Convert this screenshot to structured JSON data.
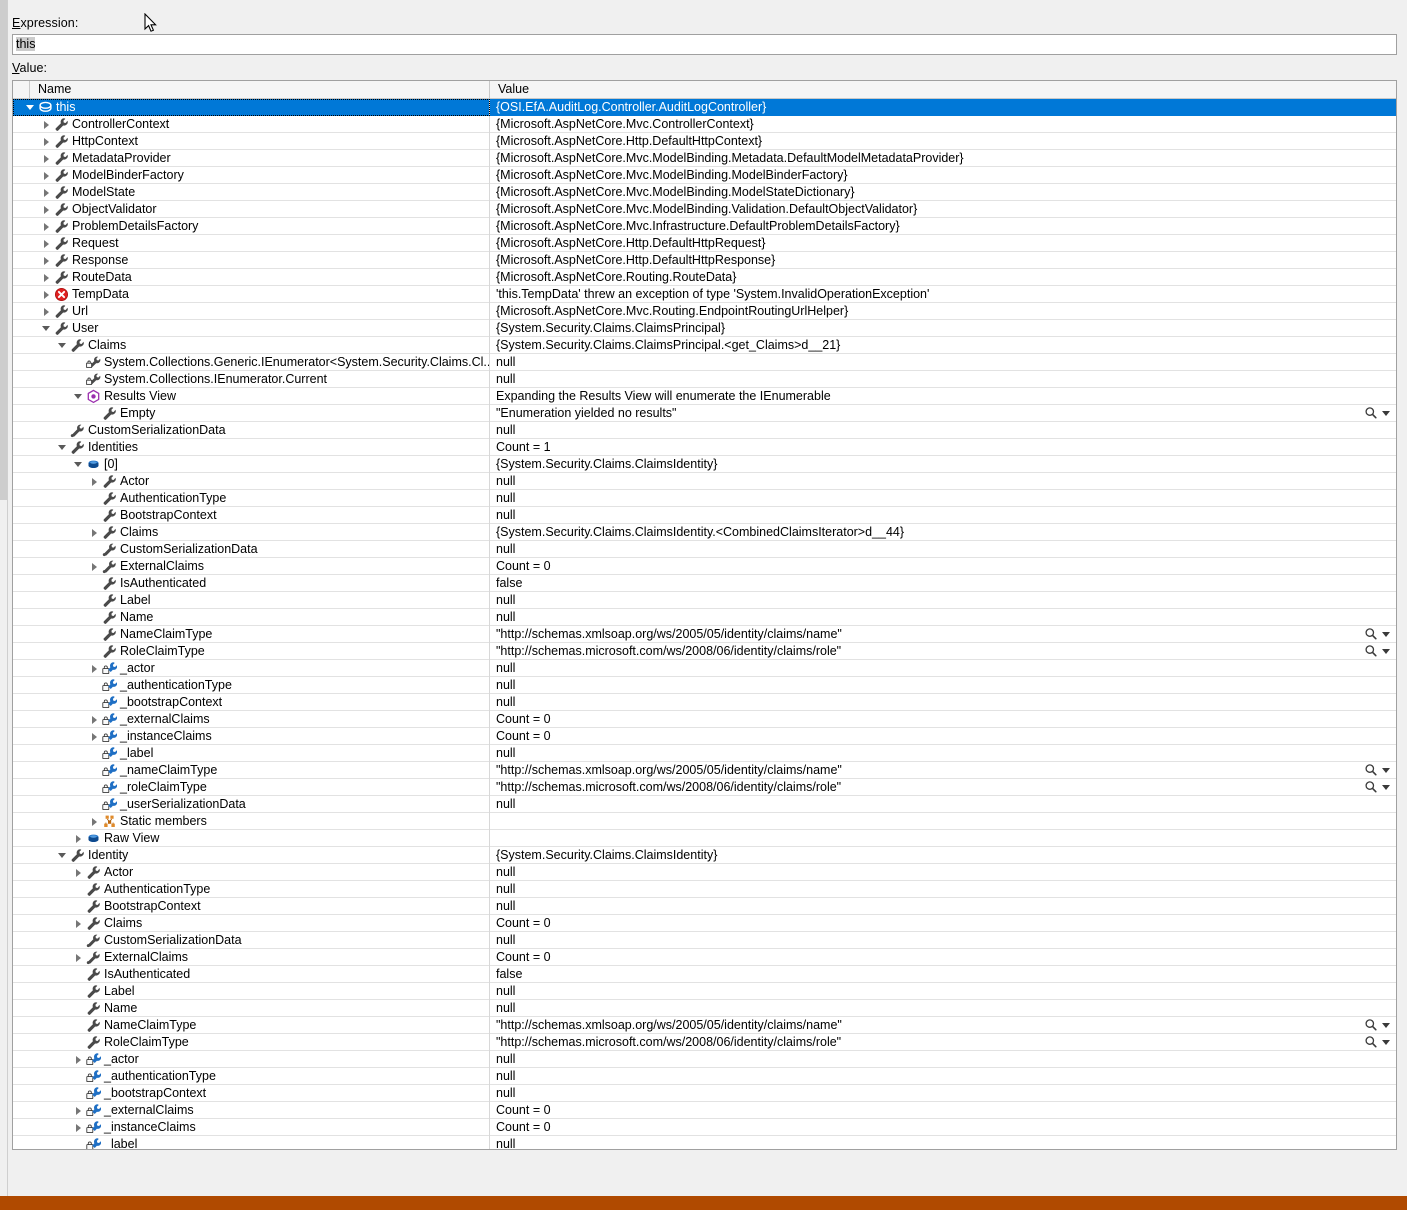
{
  "window": {
    "expression_label": "Expression:",
    "value_label": "Value:",
    "expression_value": "this",
    "accent_selection": "#0078d7",
    "frame_accent": "#b04a00"
  },
  "grid": {
    "columns": [
      "Name",
      "Value"
    ],
    "rows": [
      {
        "depth": 0,
        "twisty": "expanded",
        "icon": "class-icon",
        "name": "this",
        "value": "{OSI.EfA.AuditLog.Controller.AuditLogController}",
        "selected": true,
        "magnifier": false
      },
      {
        "depth": 1,
        "twisty": "collapsed",
        "icon": "property-icon",
        "name": "ControllerContext",
        "value": "{Microsoft.AspNetCore.Mvc.ControllerContext}",
        "selected": false,
        "magnifier": false
      },
      {
        "depth": 1,
        "twisty": "collapsed",
        "icon": "property-icon",
        "name": "HttpContext",
        "value": "{Microsoft.AspNetCore.Http.DefaultHttpContext}",
        "selected": false,
        "magnifier": false
      },
      {
        "depth": 1,
        "twisty": "collapsed",
        "icon": "property-icon",
        "name": "MetadataProvider",
        "value": "{Microsoft.AspNetCore.Mvc.ModelBinding.Metadata.DefaultModelMetadataProvider}",
        "selected": false,
        "magnifier": false
      },
      {
        "depth": 1,
        "twisty": "collapsed",
        "icon": "property-icon",
        "name": "ModelBinderFactory",
        "value": "{Microsoft.AspNetCore.Mvc.ModelBinding.ModelBinderFactory}",
        "selected": false,
        "magnifier": false
      },
      {
        "depth": 1,
        "twisty": "collapsed",
        "icon": "property-icon",
        "name": "ModelState",
        "value": "{Microsoft.AspNetCore.Mvc.ModelBinding.ModelStateDictionary}",
        "selected": false,
        "magnifier": false
      },
      {
        "depth": 1,
        "twisty": "collapsed",
        "icon": "property-icon",
        "name": "ObjectValidator",
        "value": "{Microsoft.AspNetCore.Mvc.ModelBinding.Validation.DefaultObjectValidator}",
        "selected": false,
        "magnifier": false
      },
      {
        "depth": 1,
        "twisty": "collapsed",
        "icon": "property-icon",
        "name": "ProblemDetailsFactory",
        "value": "{Microsoft.AspNetCore.Mvc.Infrastructure.DefaultProblemDetailsFactory}",
        "selected": false,
        "magnifier": false
      },
      {
        "depth": 1,
        "twisty": "collapsed",
        "icon": "property-icon",
        "name": "Request",
        "value": "{Microsoft.AspNetCore.Http.DefaultHttpRequest}",
        "selected": false,
        "magnifier": false
      },
      {
        "depth": 1,
        "twisty": "collapsed",
        "icon": "property-icon",
        "name": "Response",
        "value": "{Microsoft.AspNetCore.Http.DefaultHttpResponse}",
        "selected": false,
        "magnifier": false
      },
      {
        "depth": 1,
        "twisty": "collapsed",
        "icon": "property-icon",
        "name": "RouteData",
        "value": "{Microsoft.AspNetCore.Routing.RouteData}",
        "selected": false,
        "magnifier": false
      },
      {
        "depth": 1,
        "twisty": "collapsed",
        "icon": "error-icon",
        "name": "TempData",
        "value": "'this.TempData' threw an exception of type 'System.InvalidOperationException'",
        "selected": false,
        "magnifier": false
      },
      {
        "depth": 1,
        "twisty": "collapsed",
        "icon": "property-icon",
        "name": "Url",
        "value": "{Microsoft.AspNetCore.Mvc.Routing.EndpointRoutingUrlHelper}",
        "selected": false,
        "magnifier": false
      },
      {
        "depth": 1,
        "twisty": "expanded",
        "icon": "property-icon",
        "name": "User",
        "value": "{System.Security.Claims.ClaimsPrincipal}",
        "selected": false,
        "magnifier": false
      },
      {
        "depth": 2,
        "twisty": "expanded",
        "icon": "property-icon",
        "name": "Claims",
        "value": "{System.Security.Claims.ClaimsPrincipal.<get_Claims>d__21}",
        "selected": false,
        "magnifier": false
      },
      {
        "depth": 3,
        "twisty": "none",
        "icon": "private-property-icon",
        "name": "System.Collections.Generic.IEnumerator<System.Security.Claims.Cl...",
        "value": "null",
        "selected": false,
        "magnifier": false
      },
      {
        "depth": 3,
        "twisty": "none",
        "icon": "private-property-icon",
        "name": "System.Collections.IEnumerator.Current",
        "value": "null",
        "selected": false,
        "magnifier": false
      },
      {
        "depth": 3,
        "twisty": "expanded",
        "icon": "results-view-icon",
        "name": "Results View",
        "value": "Expanding the Results View will enumerate the IEnumerable",
        "selected": false,
        "magnifier": false
      },
      {
        "depth": 4,
        "twisty": "none",
        "icon": "property-icon",
        "name": "Empty",
        "value": "\"Enumeration yielded no results\"",
        "selected": false,
        "magnifier": true
      },
      {
        "depth": 2,
        "twisty": "none",
        "icon": "private-property-icon2",
        "name": "CustomSerializationData",
        "value": "null",
        "selected": false,
        "magnifier": false
      },
      {
        "depth": 2,
        "twisty": "expanded",
        "icon": "property-icon",
        "name": "Identities",
        "value": "Count = 1",
        "selected": false,
        "magnifier": false
      },
      {
        "depth": 3,
        "twisty": "expanded",
        "icon": "object-icon",
        "name": "[0]",
        "value": "{System.Security.Claims.ClaimsIdentity}",
        "selected": false,
        "magnifier": false
      },
      {
        "depth": 4,
        "twisty": "collapsed",
        "icon": "property-icon",
        "name": "Actor",
        "value": "null",
        "selected": false,
        "magnifier": false
      },
      {
        "depth": 4,
        "twisty": "none",
        "icon": "property-icon",
        "name": "AuthenticationType",
        "value": "null",
        "selected": false,
        "magnifier": false
      },
      {
        "depth": 4,
        "twisty": "none",
        "icon": "property-icon",
        "name": "BootstrapContext",
        "value": "null",
        "selected": false,
        "magnifier": false
      },
      {
        "depth": 4,
        "twisty": "collapsed",
        "icon": "property-icon",
        "name": "Claims",
        "value": "{System.Security.Claims.ClaimsIdentity.<CombinedClaimsIterator>d__44}",
        "selected": false,
        "magnifier": false
      },
      {
        "depth": 4,
        "twisty": "none",
        "icon": "private-property-icon2",
        "name": "CustomSerializationData",
        "value": "null",
        "selected": false,
        "magnifier": false
      },
      {
        "depth": 4,
        "twisty": "collapsed",
        "icon": "private-property-icon2",
        "name": "ExternalClaims",
        "value": "Count = 0",
        "selected": false,
        "magnifier": false
      },
      {
        "depth": 4,
        "twisty": "none",
        "icon": "property-icon",
        "name": "IsAuthenticated",
        "value": "false",
        "selected": false,
        "magnifier": false
      },
      {
        "depth": 4,
        "twisty": "none",
        "icon": "property-icon",
        "name": "Label",
        "value": "null",
        "selected": false,
        "magnifier": false
      },
      {
        "depth": 4,
        "twisty": "none",
        "icon": "property-icon",
        "name": "Name",
        "value": "null",
        "selected": false,
        "magnifier": false
      },
      {
        "depth": 4,
        "twisty": "none",
        "icon": "property-icon",
        "name": "NameClaimType",
        "value": "\"http://schemas.xmlsoap.org/ws/2005/05/identity/claims/name\"",
        "selected": false,
        "magnifier": true
      },
      {
        "depth": 4,
        "twisty": "none",
        "icon": "property-icon",
        "name": "RoleClaimType",
        "value": "\"http://schemas.microsoft.com/ws/2008/06/identity/claims/role\"",
        "selected": false,
        "magnifier": true
      },
      {
        "depth": 4,
        "twisty": "collapsed",
        "icon": "field-icon",
        "name": "_actor",
        "value": "null",
        "selected": false,
        "magnifier": false
      },
      {
        "depth": 4,
        "twisty": "none",
        "icon": "field-icon",
        "name": "_authenticationType",
        "value": "null",
        "selected": false,
        "magnifier": false
      },
      {
        "depth": 4,
        "twisty": "none",
        "icon": "field-icon",
        "name": "_bootstrapContext",
        "value": "null",
        "selected": false,
        "magnifier": false
      },
      {
        "depth": 4,
        "twisty": "collapsed",
        "icon": "field-icon",
        "name": "_externalClaims",
        "value": "Count = 0",
        "selected": false,
        "magnifier": false
      },
      {
        "depth": 4,
        "twisty": "collapsed",
        "icon": "field-icon",
        "name": "_instanceClaims",
        "value": "Count = 0",
        "selected": false,
        "magnifier": false
      },
      {
        "depth": 4,
        "twisty": "none",
        "icon": "field-icon",
        "name": "_label",
        "value": "null",
        "selected": false,
        "magnifier": false
      },
      {
        "depth": 4,
        "twisty": "none",
        "icon": "field-icon",
        "name": "_nameClaimType",
        "value": "\"http://schemas.xmlsoap.org/ws/2005/05/identity/claims/name\"",
        "selected": false,
        "magnifier": true
      },
      {
        "depth": 4,
        "twisty": "none",
        "icon": "field-icon",
        "name": "_roleClaimType",
        "value": "\"http://schemas.microsoft.com/ws/2008/06/identity/claims/role\"",
        "selected": false,
        "magnifier": true
      },
      {
        "depth": 4,
        "twisty": "none",
        "icon": "field-icon",
        "name": "_userSerializationData",
        "value": "null",
        "selected": false,
        "magnifier": false
      },
      {
        "depth": 4,
        "twisty": "collapsed",
        "icon": "static-members-icon",
        "name": "Static members",
        "value": "",
        "selected": false,
        "magnifier": false
      },
      {
        "depth": 3,
        "twisty": "collapsed",
        "icon": "object-icon",
        "name": "Raw View",
        "value": "",
        "selected": false,
        "magnifier": false
      },
      {
        "depth": 2,
        "twisty": "expanded",
        "icon": "property-icon",
        "name": "Identity",
        "value": "{System.Security.Claims.ClaimsIdentity}",
        "selected": false,
        "magnifier": false
      },
      {
        "depth": 3,
        "twisty": "collapsed",
        "icon": "property-icon",
        "name": "Actor",
        "value": "null",
        "selected": false,
        "magnifier": false
      },
      {
        "depth": 3,
        "twisty": "none",
        "icon": "property-icon",
        "name": "AuthenticationType",
        "value": "null",
        "selected": false,
        "magnifier": false
      },
      {
        "depth": 3,
        "twisty": "none",
        "icon": "property-icon",
        "name": "BootstrapContext",
        "value": "null",
        "selected": false,
        "magnifier": false
      },
      {
        "depth": 3,
        "twisty": "collapsed",
        "icon": "property-icon",
        "name": "Claims",
        "value": "Count = 0",
        "selected": false,
        "magnifier": false
      },
      {
        "depth": 3,
        "twisty": "none",
        "icon": "private-property-icon2",
        "name": "CustomSerializationData",
        "value": "null",
        "selected": false,
        "magnifier": false
      },
      {
        "depth": 3,
        "twisty": "collapsed",
        "icon": "private-property-icon2",
        "name": "ExternalClaims",
        "value": "Count = 0",
        "selected": false,
        "magnifier": false
      },
      {
        "depth": 3,
        "twisty": "none",
        "icon": "property-icon",
        "name": "IsAuthenticated",
        "value": "false",
        "selected": false,
        "magnifier": false
      },
      {
        "depth": 3,
        "twisty": "none",
        "icon": "property-icon",
        "name": "Label",
        "value": "null",
        "selected": false,
        "magnifier": false
      },
      {
        "depth": 3,
        "twisty": "none",
        "icon": "property-icon",
        "name": "Name",
        "value": "null",
        "selected": false,
        "magnifier": false
      },
      {
        "depth": 3,
        "twisty": "none",
        "icon": "property-icon",
        "name": "NameClaimType",
        "value": "\"http://schemas.xmlsoap.org/ws/2005/05/identity/claims/name\"",
        "selected": false,
        "magnifier": true
      },
      {
        "depth": 3,
        "twisty": "none",
        "icon": "property-icon",
        "name": "RoleClaimType",
        "value": "\"http://schemas.microsoft.com/ws/2008/06/identity/claims/role\"",
        "selected": false,
        "magnifier": true
      },
      {
        "depth": 3,
        "twisty": "collapsed",
        "icon": "field-icon",
        "name": "_actor",
        "value": "null",
        "selected": false,
        "magnifier": false
      },
      {
        "depth": 3,
        "twisty": "none",
        "icon": "field-icon",
        "name": "_authenticationType",
        "value": "null",
        "selected": false,
        "magnifier": false
      },
      {
        "depth": 3,
        "twisty": "none",
        "icon": "field-icon",
        "name": "_bootstrapContext",
        "value": "null",
        "selected": false,
        "magnifier": false
      },
      {
        "depth": 3,
        "twisty": "collapsed",
        "icon": "field-icon",
        "name": "_externalClaims",
        "value": "Count = 0",
        "selected": false,
        "magnifier": false
      },
      {
        "depth": 3,
        "twisty": "collapsed",
        "icon": "field-icon",
        "name": "_instanceClaims",
        "value": "Count = 0",
        "selected": false,
        "magnifier": false
      },
      {
        "depth": 3,
        "twisty": "none",
        "icon": "field-icon",
        "name": "_label",
        "value": "null",
        "selected": false,
        "magnifier": false
      }
    ]
  }
}
